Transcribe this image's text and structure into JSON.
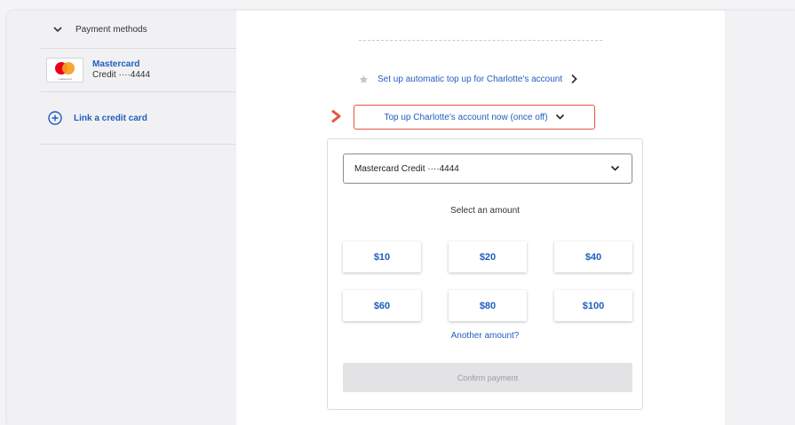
{
  "sidebar": {
    "header_label": "Payment methods",
    "card": {
      "name": "Mastercard",
      "number": "Credit ····4444",
      "logo_text": "mastercard"
    },
    "link_card_label": "Link a credit card"
  },
  "main": {
    "auto_topup_label": "Set up automatic top up for Charlotte's account",
    "topup_now_label": "Top up Charlotte's account now (once off)",
    "payment_select_value": "Mastercard Credit ····4444",
    "select_amount_label": "Select an amount",
    "amounts": [
      "$10",
      "$20",
      "$40",
      "$60",
      "$80",
      "$100"
    ],
    "another_amount_label": "Another amount?",
    "confirm_label": "Confirm payment"
  },
  "colors": {
    "link_blue": "#1f5fbf",
    "highlight_orange": "#e4553c",
    "disabled_gray": "#e3e3e5"
  },
  "icons": [
    "chevron-down-icon",
    "mastercard-logo-icon",
    "plus-circle-icon",
    "star-icon",
    "chevron-right-icon",
    "pointer-arrow-icon"
  ]
}
